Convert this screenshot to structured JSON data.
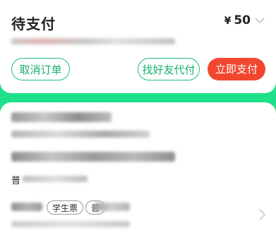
{
  "order": {
    "status_title": "待支付",
    "currency_symbol": "¥",
    "amount": "50"
  },
  "actions": {
    "cancel_label": "取消订单",
    "friend_pay_label": "找好友代付",
    "pay_now_label": "立即支付"
  },
  "ticket": {
    "partial_text": "普",
    "tags": [
      "学生票",
      "普"
    ]
  },
  "icons": {
    "expand": "chevron-down-icon",
    "detail": "chevron-right-icon"
  },
  "colors": {
    "background": "#1fe08a",
    "accent": "#21c07a",
    "pay_button": "#f2472f"
  }
}
